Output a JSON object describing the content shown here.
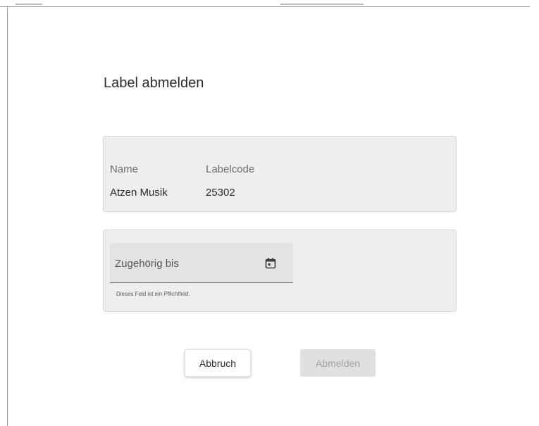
{
  "dialog": {
    "title": "Label abmelden"
  },
  "label_info": {
    "name_label": "Name",
    "name_value": "Atzen Musik",
    "code_label": "Labelcode",
    "code_value": "25302"
  },
  "date_field": {
    "label": "Zugehörig bis",
    "value": "",
    "hint": "Dieses Feld ist ein Pflichtfeld.",
    "icon": "calendar-icon"
  },
  "actions": {
    "cancel_label": "Abbruch",
    "submit_label": "Abmelden",
    "submit_disabled": true
  },
  "colors": {
    "card_background": "#eeeeee",
    "field_background": "#e3e3e3",
    "disabled_button": "#e0e0e0"
  }
}
